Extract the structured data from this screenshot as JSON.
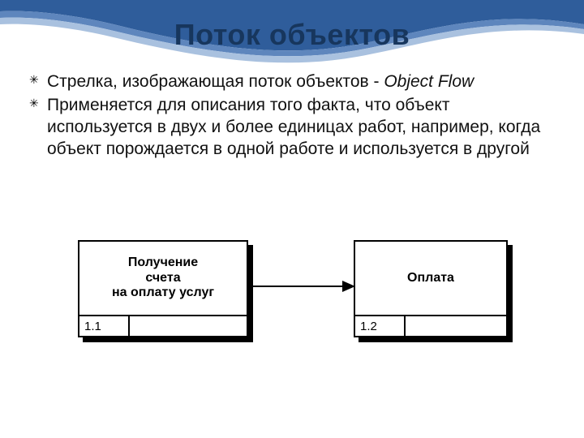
{
  "title": "Поток объектов",
  "bullets": [
    {
      "pre": "Стрелка, изображающая поток объектов - ",
      "em": "Object Flow"
    },
    {
      "pre": "Применяется для описания того факта, что объект используется в двух и более единицах работ, например, когда объект порождается в одной работе и используется в другой",
      "em": ""
    }
  ],
  "diagram": {
    "left_box": {
      "text": "Получение\nсчета\nна оплату услуг",
      "number": "1.1"
    },
    "right_box": {
      "text": "Оплата",
      "number": "1.2"
    }
  }
}
